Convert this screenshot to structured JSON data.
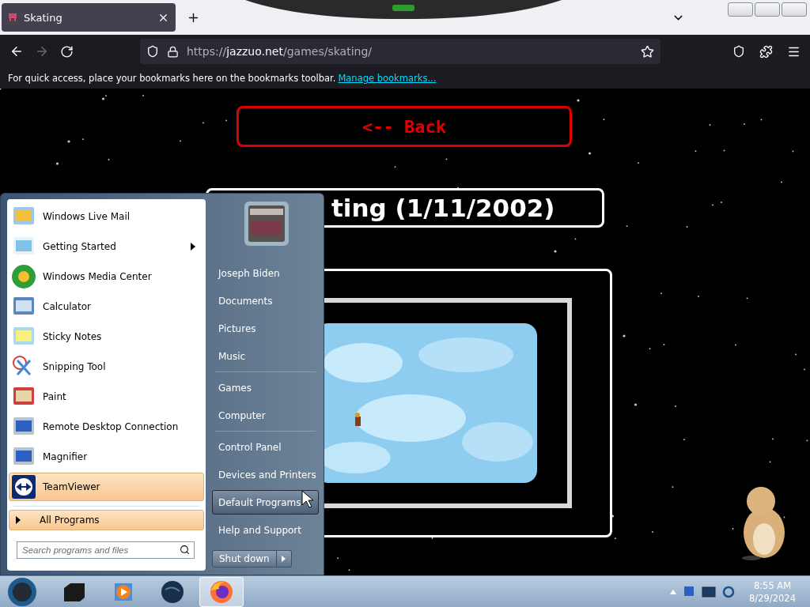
{
  "browser": {
    "tab_title": "Skating",
    "url_host": "jazzuo.net",
    "url_path": "/games/skating/",
    "url_scheme": "https://",
    "bookmarks_message": "For quick access, place your bookmarks here on the bookmarks toolbar.",
    "bookmarks_link": "Manage bookmarks..."
  },
  "page": {
    "back_button": "<-- Back",
    "title": "ting (1/11/2002)"
  },
  "start_menu": {
    "programs": [
      {
        "label": "Windows Live Mail",
        "kind": "mail",
        "has_submenu": false,
        "selected": false
      },
      {
        "label": "Getting Started",
        "kind": "doc",
        "has_submenu": true,
        "selected": false
      },
      {
        "label": "Windows Media Center",
        "kind": "media",
        "has_submenu": false,
        "selected": false
      },
      {
        "label": "Calculator",
        "kind": "calc",
        "has_submenu": false,
        "selected": false
      },
      {
        "label": "Sticky Notes",
        "kind": "notes",
        "has_submenu": false,
        "selected": false
      },
      {
        "label": "Snipping Tool",
        "kind": "scissors",
        "has_submenu": false,
        "selected": false
      },
      {
        "label": "Paint",
        "kind": "paint",
        "has_submenu": false,
        "selected": false
      },
      {
        "label": "Remote Desktop Connection",
        "kind": "monitor",
        "has_submenu": false,
        "selected": false
      },
      {
        "label": "Magnifier",
        "kind": "monitor",
        "has_submenu": false,
        "selected": false
      },
      {
        "label": "TeamViewer",
        "kind": "teamviewer",
        "has_submenu": false,
        "selected": true
      }
    ],
    "all_programs": "All Programs",
    "search_placeholder": "Search programs and files",
    "places": [
      {
        "label": "Joseph Biden",
        "separator_before": false,
        "selected": false
      },
      {
        "label": "Documents",
        "separator_before": false,
        "selected": false
      },
      {
        "label": "Pictures",
        "separator_before": false,
        "selected": false
      },
      {
        "label": "Music",
        "separator_before": false,
        "selected": false
      },
      {
        "label": "Games",
        "separator_before": true,
        "selected": false
      },
      {
        "label": "Computer",
        "separator_before": false,
        "selected": false
      },
      {
        "label": "Control Panel",
        "separator_before": true,
        "selected": false
      },
      {
        "label": "Devices and Printers",
        "separator_before": false,
        "selected": false
      },
      {
        "label": "Default Programs",
        "separator_before": false,
        "selected": true
      },
      {
        "label": "Help and Support",
        "separator_before": false,
        "selected": false
      }
    ],
    "shutdown": "Shut down"
  },
  "taskbar": {
    "apps": [
      {
        "kind": "box",
        "selected": false
      },
      {
        "kind": "player",
        "selected": false
      },
      {
        "kind": "globe",
        "selected": false
      },
      {
        "kind": "firefox",
        "selected": true
      }
    ],
    "time": "8:55 AM",
    "date": "8/29/2024"
  }
}
